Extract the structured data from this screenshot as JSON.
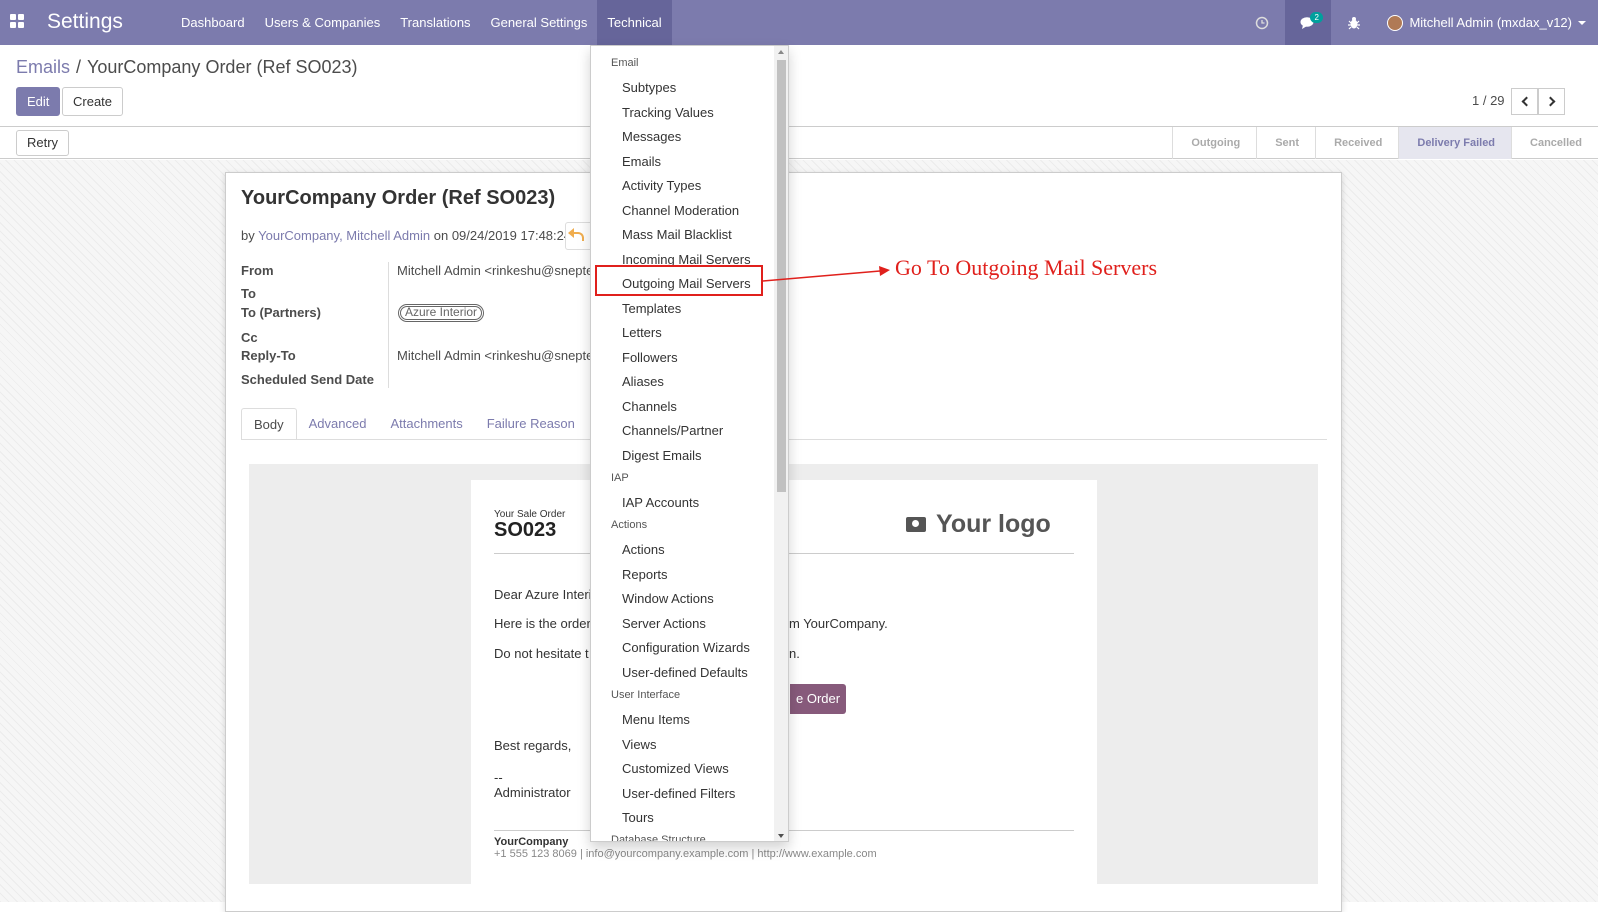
{
  "navbar": {
    "brand": "Settings",
    "menu": [
      "Dashboard",
      "Users & Companies",
      "Translations",
      "General Settings",
      "Technical"
    ],
    "active_menu": "Technical",
    "message_badge": "2",
    "user": "Mitchell Admin (mxdax_v12)",
    "icons": [
      "apps-grid-icon",
      "clock-icon",
      "chat-icon",
      "bug-icon"
    ]
  },
  "control_panel": {
    "breadcrumb_parent": "Emails",
    "breadcrumb_sep": "/",
    "breadcrumb_current": "YourCompany Order (Ref SO023)",
    "edit_label": "Edit",
    "create_label": "Create",
    "pager": "1 / 29"
  },
  "statusbar": {
    "retry_label": "Retry",
    "steps": [
      "Outgoing",
      "Sent",
      "Received",
      "Delivery Failed",
      "Cancelled"
    ],
    "current_step": "Delivery Failed"
  },
  "mail": {
    "subject": "YourCompany Order (Ref SO023)",
    "by_prefix": "by",
    "authors": "YourCompany, Mitchell Admin",
    "date_prefix": "on",
    "date": "09/24/2019 17:48:24",
    "fields": {
      "from_label": "From",
      "from_value": "Mitchell Admin <rinkeshu@snepte",
      "to_label": "To",
      "to_partners_label": "To (Partners)",
      "to_partners_tag": "Azure Interior",
      "cc_label": "Cc",
      "reply_to_label": "Reply-To",
      "reply_to_value": "Mitchell Admin <rinkeshu@snepte",
      "scheduled_label": "Scheduled Send Date"
    },
    "tabs": [
      "Body",
      "Advanced",
      "Attachments",
      "Failure Reason"
    ],
    "active_tab": "Body"
  },
  "email_body": {
    "order_caption": "Your Sale Order",
    "order_ref": "SO023",
    "logo_text": "Your logo",
    "lines": {
      "greeting": "Dear Azure Interi",
      "here_is": "Here is the order",
      "here_is_tail": "m YourCompany.",
      "hesitate": "Do not hesitate t",
      "hesitate_tail": "n.",
      "best_regards": "Best regards,",
      "dashes": "--",
      "signature": "Administrator"
    },
    "button_label": "e Order",
    "footer_company": "YourCompany",
    "footer_info": "+1 555 123 8069 | info@yourcompany.example.com | http://www.example.com"
  },
  "technical_menu": {
    "sections": [
      {
        "header": "Email",
        "items": [
          "Subtypes",
          "Tracking Values",
          "Messages",
          "Emails",
          "Activity Types",
          "Channel Moderation",
          "Mass Mail Blacklist",
          "Incoming Mail Servers",
          "Outgoing Mail Servers",
          "Templates",
          "Letters",
          "Followers",
          "Aliases",
          "Channels",
          "Channels/Partner",
          "Digest Emails"
        ]
      },
      {
        "header": "IAP",
        "items": [
          "IAP Accounts"
        ]
      },
      {
        "header": "Actions",
        "items": [
          "Actions",
          "Reports",
          "Window Actions",
          "Server Actions",
          "Configuration Wizards",
          "User-defined Defaults"
        ]
      },
      {
        "header": "User Interface",
        "items": [
          "Menu Items",
          "Views",
          "Customized Views",
          "User-defined Filters",
          "Tours"
        ]
      },
      {
        "header": "Database Structure",
        "items": []
      }
    ],
    "highlighted_item": "Outgoing Mail Servers"
  },
  "annotation": {
    "text": "Go To Outgoing Mail Servers",
    "color": "#e0201c"
  },
  "colors": {
    "brand": "#7c7bad",
    "brand_dark": "#66659a",
    "button_primary": "#875a7b",
    "badge": "#00a09d"
  }
}
